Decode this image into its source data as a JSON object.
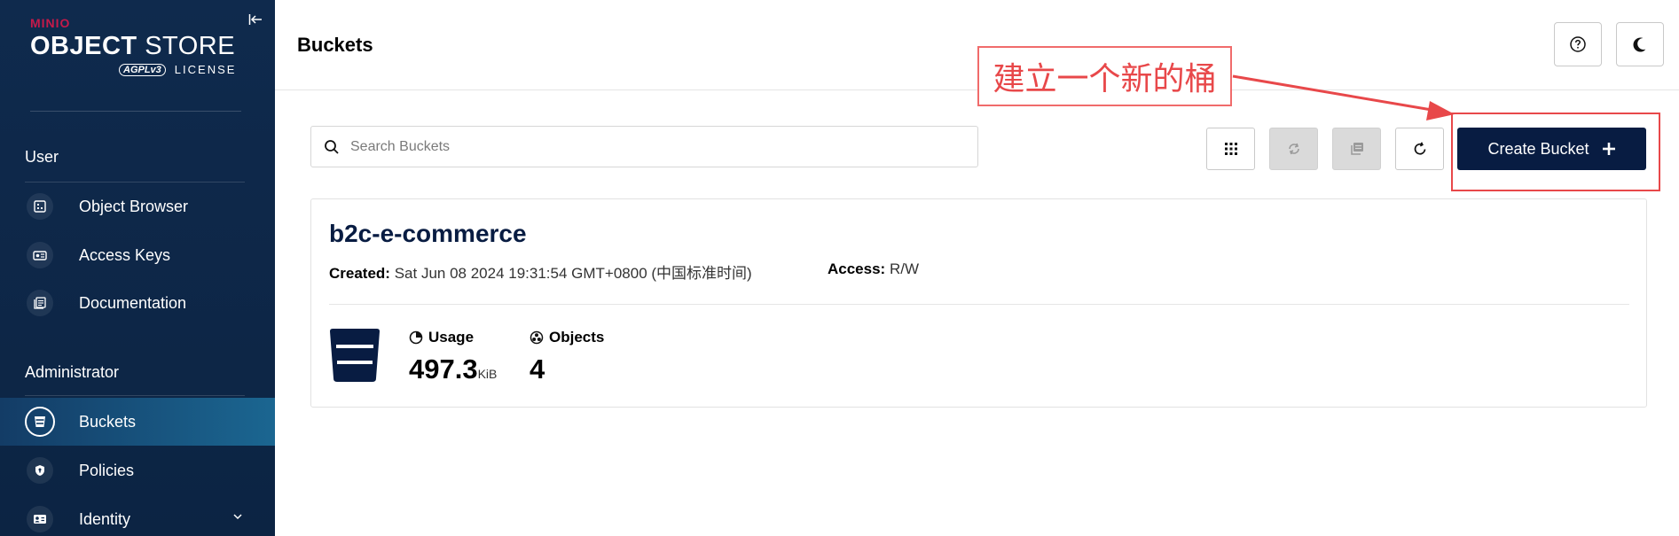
{
  "sidebar": {
    "brand_top": "MINIO",
    "brand_main_bold": "OBJECT",
    "brand_main_light": "STORE",
    "brand_badge": "AGPLv3",
    "brand_license": "LICENSE",
    "sections": [
      {
        "title": "User"
      },
      {
        "title": "Administrator"
      }
    ],
    "user_items": [
      {
        "label": "Object Browser",
        "icon": "object-browser-icon"
      },
      {
        "label": "Access Keys",
        "icon": "access-keys-icon"
      },
      {
        "label": "Documentation",
        "icon": "documentation-icon"
      }
    ],
    "admin_items": [
      {
        "label": "Buckets",
        "icon": "bucket-icon",
        "active": true
      },
      {
        "label": "Policies",
        "icon": "shield-icon"
      },
      {
        "label": "Identity",
        "icon": "identity-icon",
        "expandable": true
      }
    ]
  },
  "header": {
    "title": "Buckets"
  },
  "toolbar": {
    "search_placeholder": "Search Buckets",
    "create_label": "Create Bucket"
  },
  "bucket": {
    "name": "b2c-e-commerce",
    "created_label": "Created:",
    "created_value": "Sat Jun 08 2024 19:31:54 GMT+0800 (中国标准时间)",
    "access_label": "Access:",
    "access_value": "R/W",
    "usage_label": "Usage",
    "usage_value": "497.3",
    "usage_unit": "KiB",
    "objects_label": "Objects",
    "objects_value": "4"
  },
  "annotation": {
    "text": "建立一个新的桶",
    "color": "#e8484a"
  },
  "colors": {
    "sidebar_bg": "#0f2a4d",
    "active_item": "#1b6691",
    "primary_button": "#081c42",
    "brand_red": "#c51a4a"
  }
}
